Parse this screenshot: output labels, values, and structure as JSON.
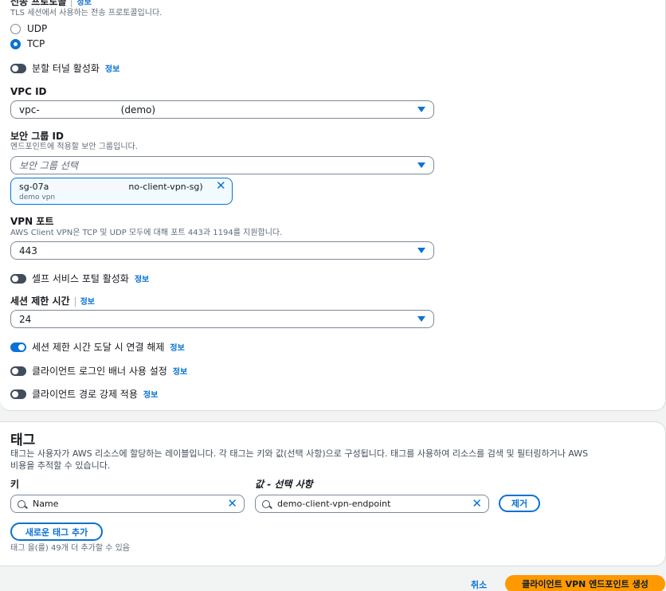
{
  "protocol": {
    "label": "전송 프로토콜",
    "info": "정보",
    "description": "TLS 세션에서 사용하는 전송 프로토콜입니다.",
    "options": [
      {
        "label": "UDP",
        "checked": false
      },
      {
        "label": "TCP",
        "checked": true
      }
    ]
  },
  "split_tunnel": {
    "label": "분할 터널 활성화",
    "info": "정보",
    "enabled": false
  },
  "vpc": {
    "label": "VPC ID",
    "value_prefix": "vpc-",
    "value_suffix": "(demo)"
  },
  "security_group": {
    "label": "보안 그룹 ID",
    "description": "엔드포인트에 적용할 보안 그룹입니다.",
    "placeholder": "보안 그룹 선택",
    "token": {
      "id_prefix": "sg-07a",
      "id_suffix": "no-client-vpn-sg)",
      "name": "demo vpn"
    }
  },
  "vpn_port": {
    "label": "VPN 포트",
    "description": "AWS Client VPN은 TCP 및 UDP 모두에 대해 포트 443과 1194를 지원합니다.",
    "value": "443"
  },
  "self_service": {
    "label": "셀프 서비스 포털 활성화",
    "info": "정보",
    "enabled": false
  },
  "session_timeout": {
    "label": "세션 제한 시간",
    "info": "정보",
    "value": "24"
  },
  "disconnect_on_timeout": {
    "label": "세션 제한 시간 도달 시 연결 해제",
    "info": "정보",
    "enabled": true
  },
  "login_banner": {
    "label": "클라이언트 로그인 배너 사용 설정",
    "info": "정보",
    "enabled": false
  },
  "route_enforcement": {
    "label": "클라이언트 경로 강제 적용",
    "info": "정보",
    "enabled": false
  },
  "tags": {
    "title": "태그",
    "description_line1": "태그는 사용자가 AWS 리소스에 할당하는 레이블입니다. 각 태그는 키와 값(선택 사항)으로 구성됩니다. 태그를 사용하여 리소스를 검색 및 필터링하거나 AWS",
    "description_line2": "비용을 추적할 수 있습니다.",
    "key_label": "키",
    "value_label": "값 - 선택 사항",
    "key_value": "Name",
    "value_value": "demo-client-vpn-endpoint",
    "remove_label": "제거",
    "add_label": "새로운 태그 추가",
    "limit_text": "태그 을(를) 49개 더 추가할 수 있음"
  },
  "footer": {
    "cancel_label": "취소",
    "create_label": "클라이언트 VPN 엔드포인트 생성"
  },
  "colors": {
    "accent": "#0972d3",
    "primary_button": "#ff9900"
  }
}
